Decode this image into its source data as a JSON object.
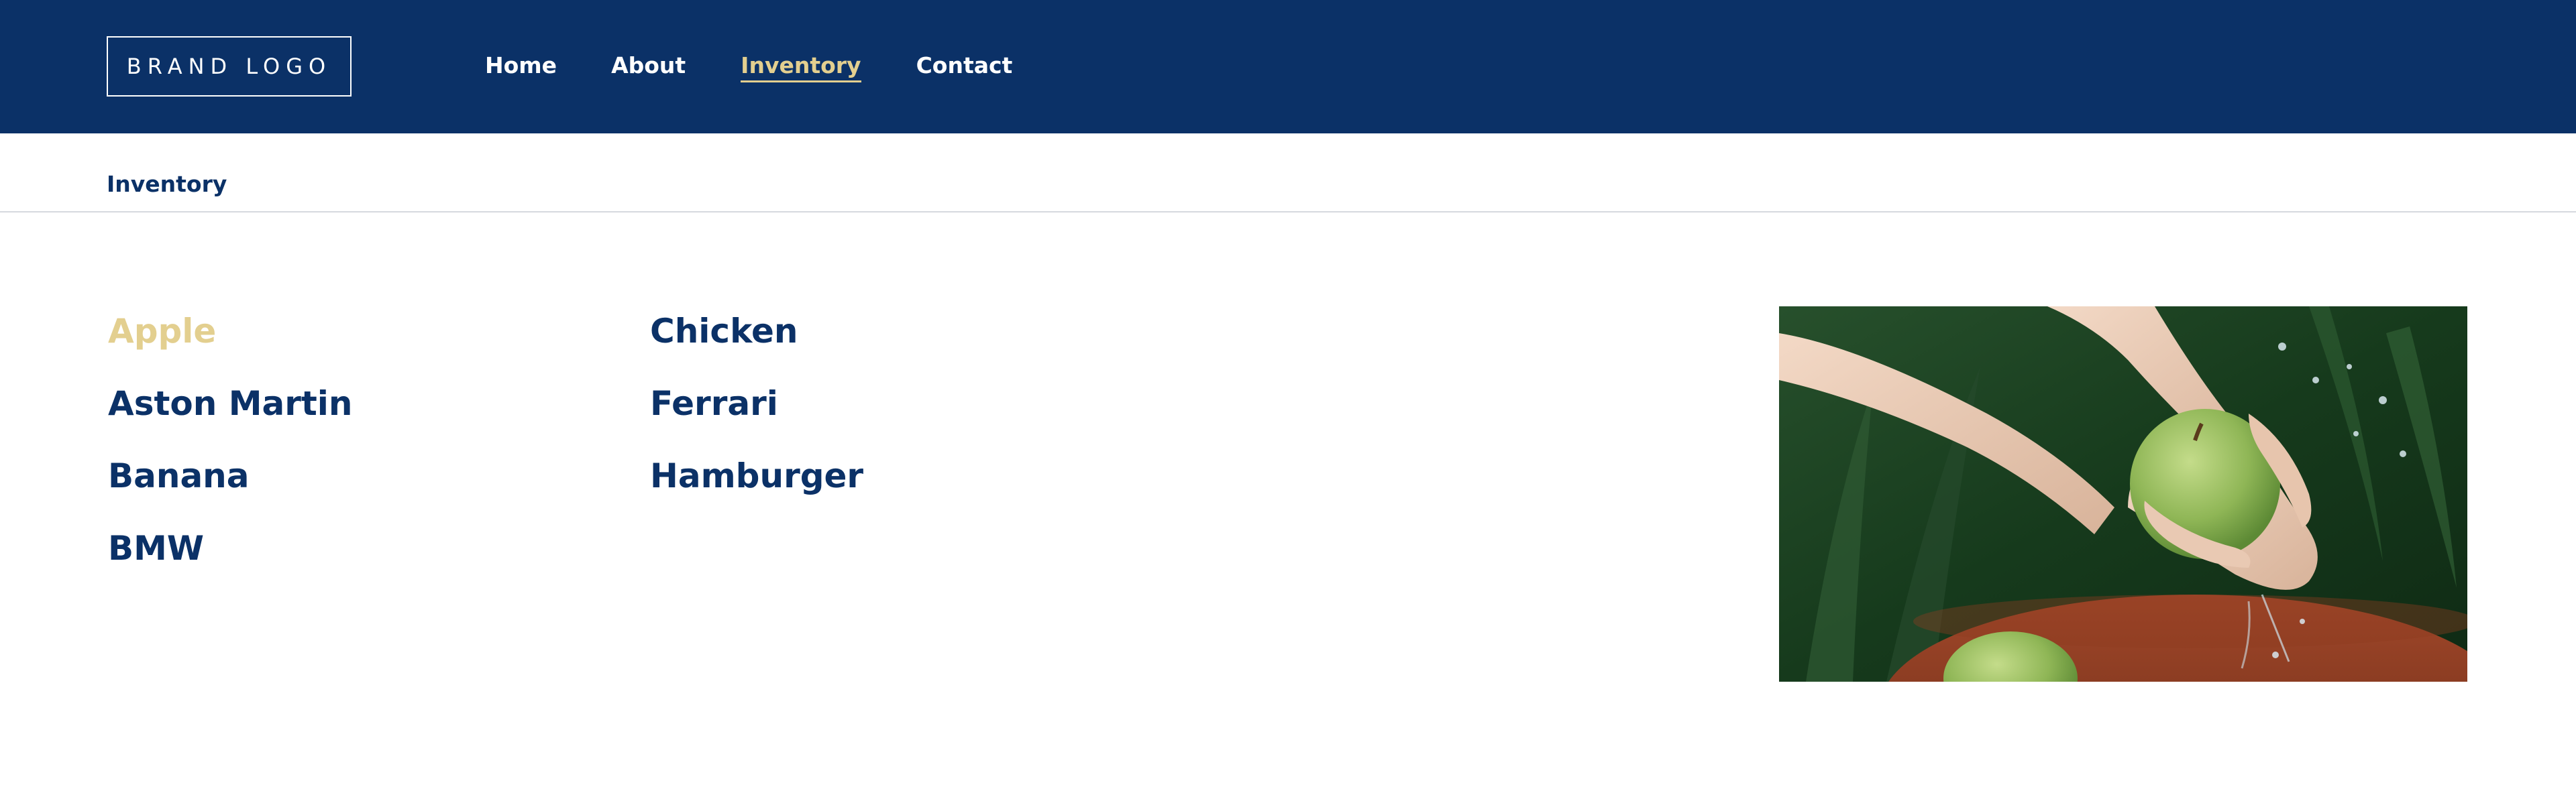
{
  "header": {
    "brand_label": "BRAND LOGO",
    "nav": [
      {
        "label": "Home",
        "active": false
      },
      {
        "label": "About",
        "active": false
      },
      {
        "label": "Inventory",
        "active": true
      },
      {
        "label": "Contact",
        "active": false
      }
    ]
  },
  "page": {
    "title": "Inventory"
  },
  "inventory": {
    "column_a": [
      "Apple",
      "Aston Martin",
      "Banana",
      "BMW"
    ],
    "column_b": [
      "Chicken",
      "Ferrari",
      "Hamburger"
    ],
    "highlighted_item": "Apple"
  },
  "image": {
    "subject": "hands washing green apple"
  },
  "colors": {
    "brand_navy": "#0b3167",
    "accent_gold": "#e3cf8f",
    "divider": "#d6d9de"
  }
}
